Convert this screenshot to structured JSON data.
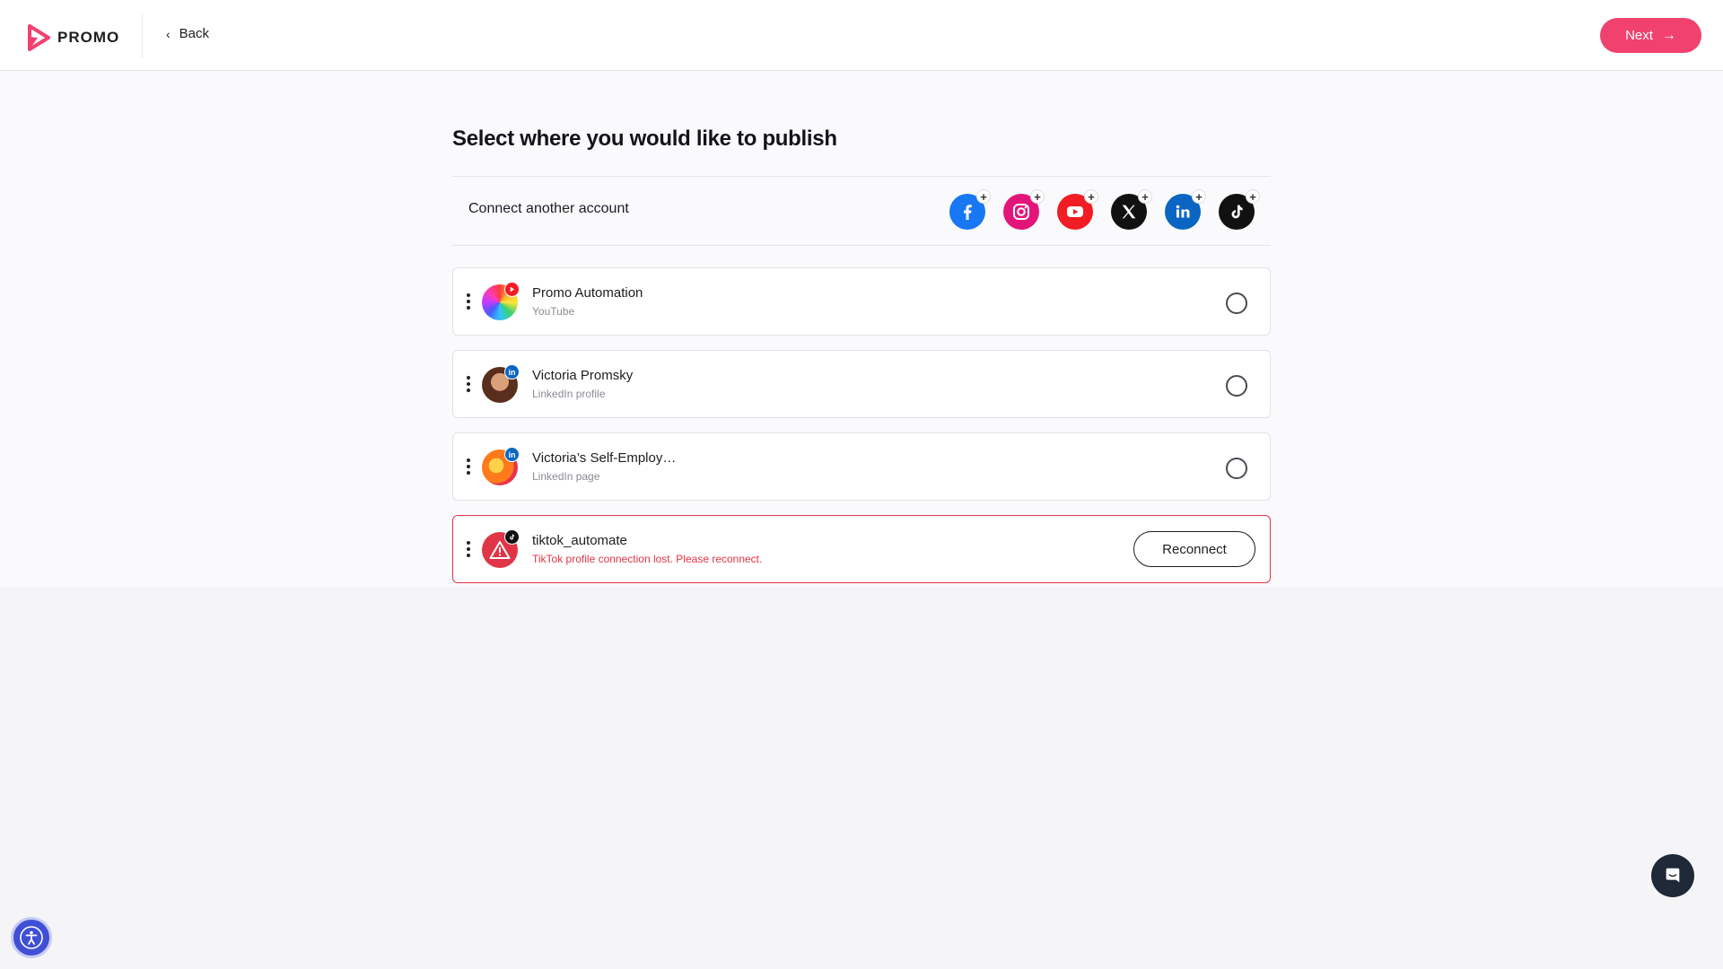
{
  "header": {
    "logo_text": "PROMO",
    "back_label": "Back",
    "next_label": "Next"
  },
  "page": {
    "title": "Select where you would like to publish"
  },
  "connect": {
    "label": "Connect another account",
    "networks": [
      "facebook",
      "instagram",
      "youtube",
      "x",
      "linkedin",
      "tiktok"
    ]
  },
  "accounts": [
    {
      "name": "Promo Automation",
      "type": "YouTube",
      "network": "youtube",
      "selected": false
    },
    {
      "name": "Victoria Promsky",
      "type": "LinkedIn profile",
      "network": "linkedin",
      "selected": false
    },
    {
      "name": "Victoria’s Self-Employ…",
      "type": "LinkedIn page",
      "network": "linkedin",
      "selected": false
    },
    {
      "name": "tiktok_automate",
      "type": "TikTok profile connection lost. Please reconnect.",
      "network": "tiktok",
      "status": "error",
      "action_label": "Reconnect"
    }
  ],
  "colors": {
    "accent": "#f1416e",
    "error": "#e03546",
    "facebook": "#1877f2",
    "instagram": "#e4157a",
    "youtube": "#f21c24",
    "linkedin": "#0a66c2",
    "x": "#111111",
    "tiktok": "#111111"
  },
  "icons": {
    "chat": "chat-bubble-icon",
    "accessibility": "accessibility-person-icon"
  }
}
